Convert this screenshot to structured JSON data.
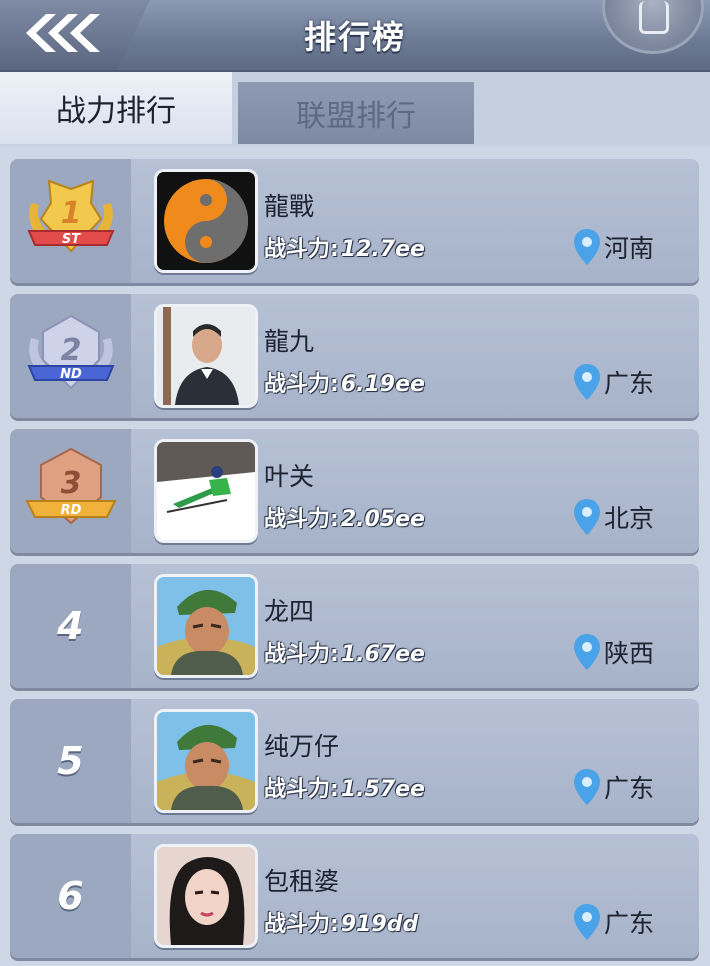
{
  "header": {
    "title": "排行榜",
    "back_icon": "triple-chevron-left-icon",
    "corner_icon": "menu-circle-icon"
  },
  "tabs": [
    {
      "label": "战力排行",
      "active": true
    },
    {
      "label": "联盟排行",
      "active": false
    }
  ],
  "colors": {
    "gold": "#e8b437",
    "silver": "#aab1d4",
    "bronze": "#d99070",
    "pin": "#4aa3e8"
  },
  "rankings": [
    {
      "rank": "1",
      "suffix": "ST",
      "name": "龍戰",
      "power_label": "战斗力:",
      "power": "12.7ee",
      "location": "河南"
    },
    {
      "rank": "2",
      "suffix": "ND",
      "name": "龍九",
      "power_label": "战斗力:",
      "power": "6.19ee",
      "location": "广东"
    },
    {
      "rank": "3",
      "suffix": "RD",
      "name": "叶关",
      "power_label": "战斗力:",
      "power": "2.05ee",
      "location": "北京"
    },
    {
      "rank": "4",
      "name": "龙四",
      "power_label": "战斗力:",
      "power": "1.67ee",
      "location": "陕西"
    },
    {
      "rank": "5",
      "name": "纯万仔",
      "power_label": "战斗力:",
      "power": "1.57ee",
      "location": "广东"
    },
    {
      "rank": "6",
      "name": "包租婆",
      "power_label": "战斗力:",
      "power": "919dd",
      "location": "广东"
    }
  ]
}
